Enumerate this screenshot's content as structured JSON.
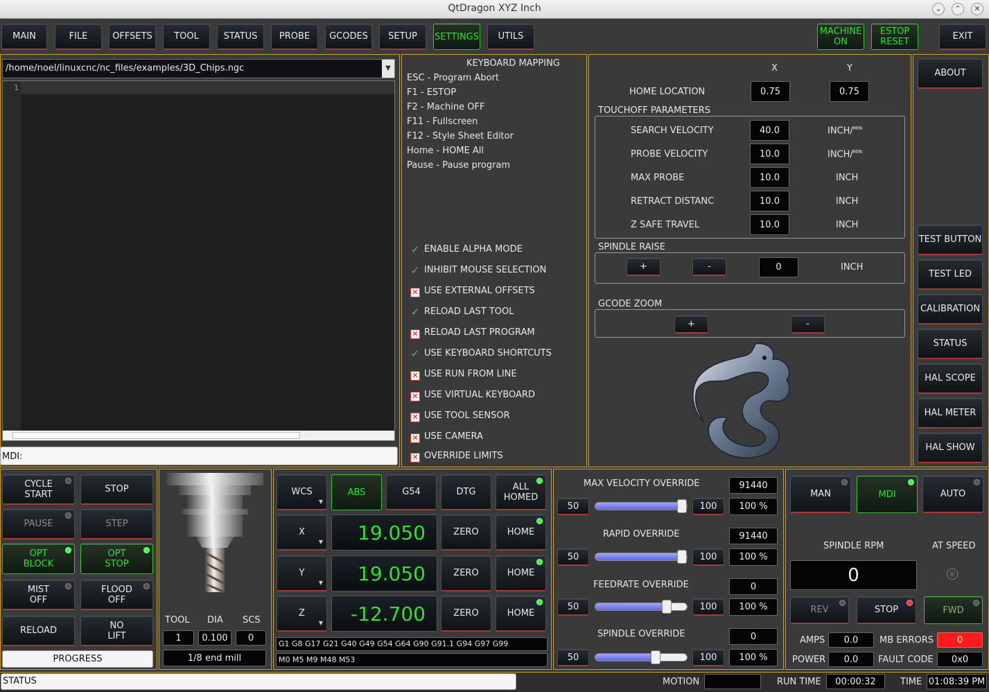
{
  "window": {
    "title": "QtDragon XYZ Inch",
    "btn_min": "⌄",
    "btn_max": "⌃",
    "btn_close": "✕"
  },
  "tabs": [
    "MAIN",
    "FILE",
    "OFFSETS",
    "TOOL",
    "STATUS",
    "PROBE",
    "GCODES",
    "SETUP",
    "SETTINGS",
    "UTILS"
  ],
  "top_right": {
    "machine_on": "MACHINE\nON",
    "estop_reset": "ESTOP\nRESET",
    "exit": "EXIT"
  },
  "file_path": "/home/noel/linuxcnc/nc_files/examples/3D_Chips.ngc",
  "editor_line": "1",
  "mdi_label": "MDI:",
  "keymap": {
    "title": "KEYBOARD MAPPING",
    "lines": [
      "ESC - Program Abort",
      "F1 - ESTOP",
      "F2 - Machine OFF",
      "F11 - Fullscreen",
      "F12 - Style Sheet Editor",
      "Home - HOME All",
      "Pause - Pause program"
    ]
  },
  "options": [
    {
      "label": "ENABLE ALPHA MODE",
      "checked": true
    },
    {
      "label": "INHIBIT MOUSE SELECTION",
      "checked": true
    },
    {
      "label": "USE EXTERNAL OFFSETS",
      "checked": false
    },
    {
      "label": "RELOAD LAST TOOL",
      "checked": true
    },
    {
      "label": "RELOAD LAST PROGRAM",
      "checked": false
    },
    {
      "label": "USE KEYBOARD SHORTCUTS",
      "checked": true
    },
    {
      "label": "USE RUN FROM LINE",
      "checked": false
    },
    {
      "label": "USE VIRTUAL KEYBOARD",
      "checked": false
    },
    {
      "label": "USE TOOL SENSOR",
      "checked": false
    },
    {
      "label": "USE CAMERA",
      "checked": false
    },
    {
      "label": "OVERRIDE LIMITS",
      "checked": false
    }
  ],
  "settings": {
    "col_x": "X",
    "col_y": "Y",
    "home_location": {
      "label": "HOME LOCATION",
      "x": "0.75",
      "y": "0.75"
    },
    "touchoff_title": "TOUCHOFF PARAMETERS",
    "touchoff": [
      {
        "label": "SEARCH VELOCITY",
        "value": "40.0",
        "unit": "INCH/",
        "unit_sup": "MIN"
      },
      {
        "label": "PROBE VELOCITY",
        "value": "10.0",
        "unit": "INCH/",
        "unit_sup": "MIN"
      },
      {
        "label": "MAX PROBE",
        "value": "10.0",
        "unit": "INCH",
        "unit_sup": ""
      },
      {
        "label": "RETRACT DISTANC",
        "value": "10.0",
        "unit": "INCH",
        "unit_sup": ""
      },
      {
        "label": "Z SAFE TRAVEL",
        "value": "10.0",
        "unit": "INCH",
        "unit_sup": ""
      }
    ],
    "spindle_raise": {
      "title": "SPINDLE RAISE",
      "plus": "+",
      "minus": "-",
      "value": "0",
      "unit": "INCH"
    },
    "gcode_zoom": {
      "title": "GCODE ZOOM",
      "plus": "+",
      "minus": "-"
    }
  },
  "side_buttons": [
    "ABOUT",
    "TEST BUTTON",
    "TEST LED",
    "CALIBRATION",
    "STATUS",
    "HAL SCOPE",
    "HAL METER",
    "HAL SHOW"
  ],
  "control": {
    "cycle_start": "CYCLE\nSTART",
    "stop": "STOP",
    "pause": "PAUSE",
    "step": "STEP",
    "opt_block": "OPT\nBLOCK",
    "opt_stop": "OPT\nSTOP",
    "mist": "MIST\nOFF",
    "flood": "FLOOD\nOFF",
    "reload": "RELOAD",
    "no_lift": "NO\nLIFT",
    "progress": "PROGRESS"
  },
  "tool": {
    "h_tool": "TOOL",
    "h_dia": "DIA",
    "h_scs": "SCS",
    "tool": "1",
    "dia": "0.100",
    "scs": "0",
    "desc": "1/8 end mill"
  },
  "dro": {
    "wcs": "WCS",
    "abs": "ABS",
    "g54": "G54",
    "dtg": "DTG",
    "all_homed": "ALL\nHOMED",
    "axes": [
      {
        "name": "X",
        "value": "19.050",
        "zero": "ZERO",
        "home": "HOME"
      },
      {
        "name": "Y",
        "value": "19.050",
        "zero": "ZERO",
        "home": "HOME"
      },
      {
        "name": "Z",
        "value": "-12.700",
        "zero": "ZERO",
        "home": "HOME"
      }
    ],
    "gcodes": "G1 G8 G17 G21 G40 G49 G54 G64 G90 G91.1 G94 G97 G99",
    "mcodes": "M0 M5 M9 M48 M53"
  },
  "overrides": [
    {
      "title": "MAX VELOCITY OVERRIDE",
      "value": "91440",
      "min": "50",
      "max": "100",
      "pct": "100 %",
      "level": 1.0
    },
    {
      "title": "RAPID OVERRIDE",
      "value": "91440",
      "min": "50",
      "max": "100",
      "pct": "100 %",
      "level": 1.0
    },
    {
      "title": "FEEDRATE OVERRIDE",
      "value": "0",
      "min": "50",
      "max": "100",
      "pct": "100 %",
      "level": 0.78
    },
    {
      "title": "SPINDLE OVERRIDE",
      "value": "0",
      "min": "50",
      "max": "100",
      "pct": "100 %",
      "level": 0.66
    }
  ],
  "spindle": {
    "man": "MAN",
    "mdi": "MDI",
    "auto": "AUTO",
    "rpm_label": "SPINDLE RPM",
    "at_speed": "AT SPEED",
    "rpm": "0",
    "rev": "REV",
    "stop": "STOP",
    "fwd": "FWD",
    "amps_label": "AMPS",
    "amps": "0.0",
    "mb_errors_label": "MB ERRORS",
    "mb_errors": "0",
    "power_label": "POWER",
    "power": "0.0",
    "fault_label": "FAULT CODE",
    "fault": "0x0"
  },
  "statusbar": {
    "status": "STATUS",
    "motion_label": "MOTION",
    "motion": "",
    "runtime_label": "RUN TIME",
    "runtime": "00:00:32",
    "time_label": "TIME",
    "time": "01:08:39 PM"
  }
}
